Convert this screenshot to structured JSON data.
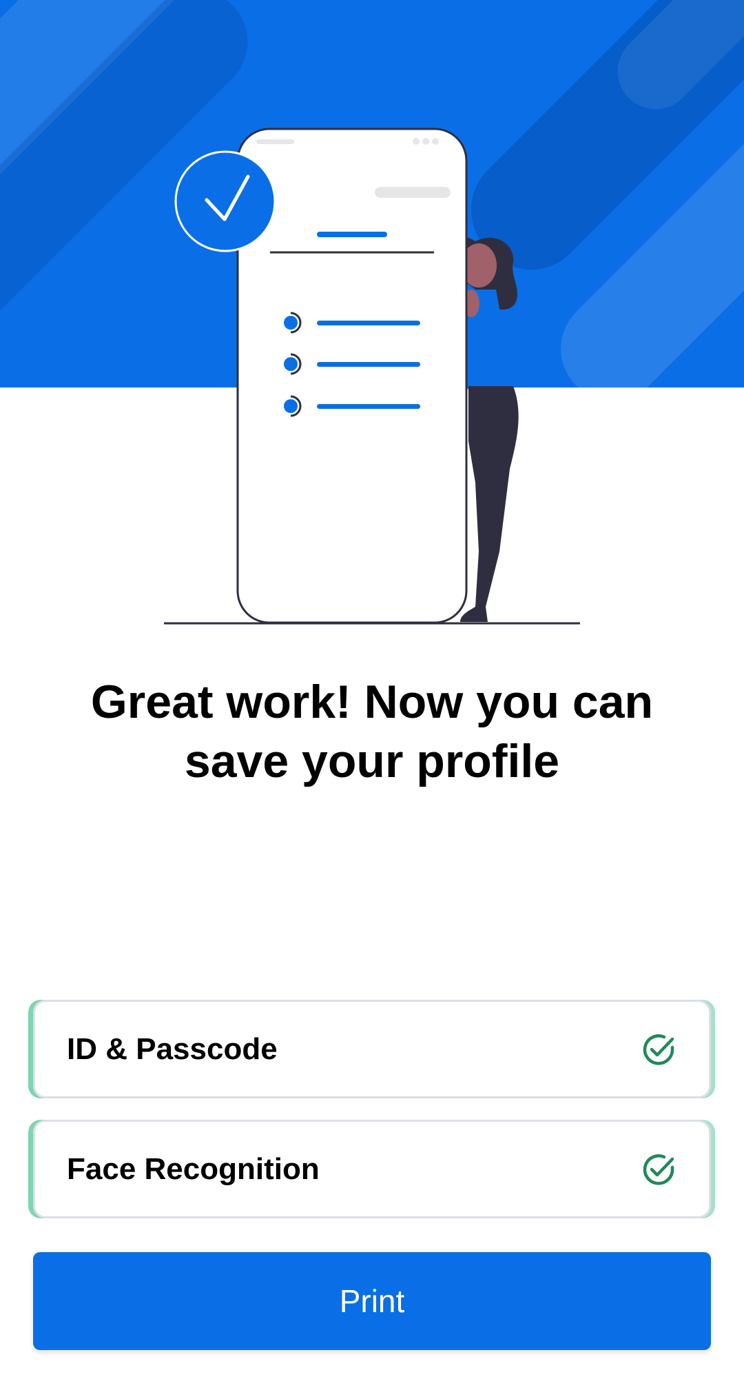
{
  "colors": {
    "accent": "#0a6fe6",
    "success": "#1e8a5a",
    "card_edge": "#7dd6b0"
  },
  "hero": {
    "illustration": "woman-beside-phone-checklist"
  },
  "headline": {
    "text": "Great work! Now you can save your profile"
  },
  "verification_items": [
    {
      "label": "ID & Passcode",
      "icon": "check-circle-icon"
    },
    {
      "label": "Face Recognition",
      "icon": "check-circle-icon"
    }
  ],
  "actions": {
    "print_label": "Print"
  }
}
